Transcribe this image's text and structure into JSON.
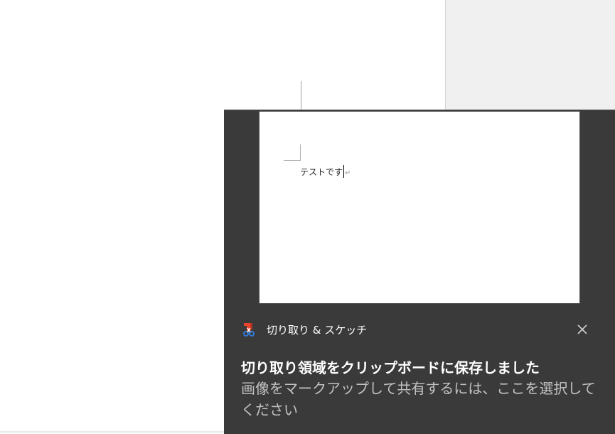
{
  "document": {
    "preview_text": "テストです",
    "paragraph_mark": "↵"
  },
  "toast": {
    "app_name": "切り取り & スケッチ",
    "title": "切り取り領域をクリップボードに保存しました",
    "body": "画像をマークアップして共有するには、ここを選択してください",
    "app_icon": "snip-and-sketch-icon",
    "close_icon": "close-icon"
  },
  "colors": {
    "toast_background": "#3a3a3a",
    "title_text": "#ffffff",
    "body_text": "#c2c2c2",
    "icon_red": "#e8452c",
    "icon_blue": "#2f7bd8"
  }
}
